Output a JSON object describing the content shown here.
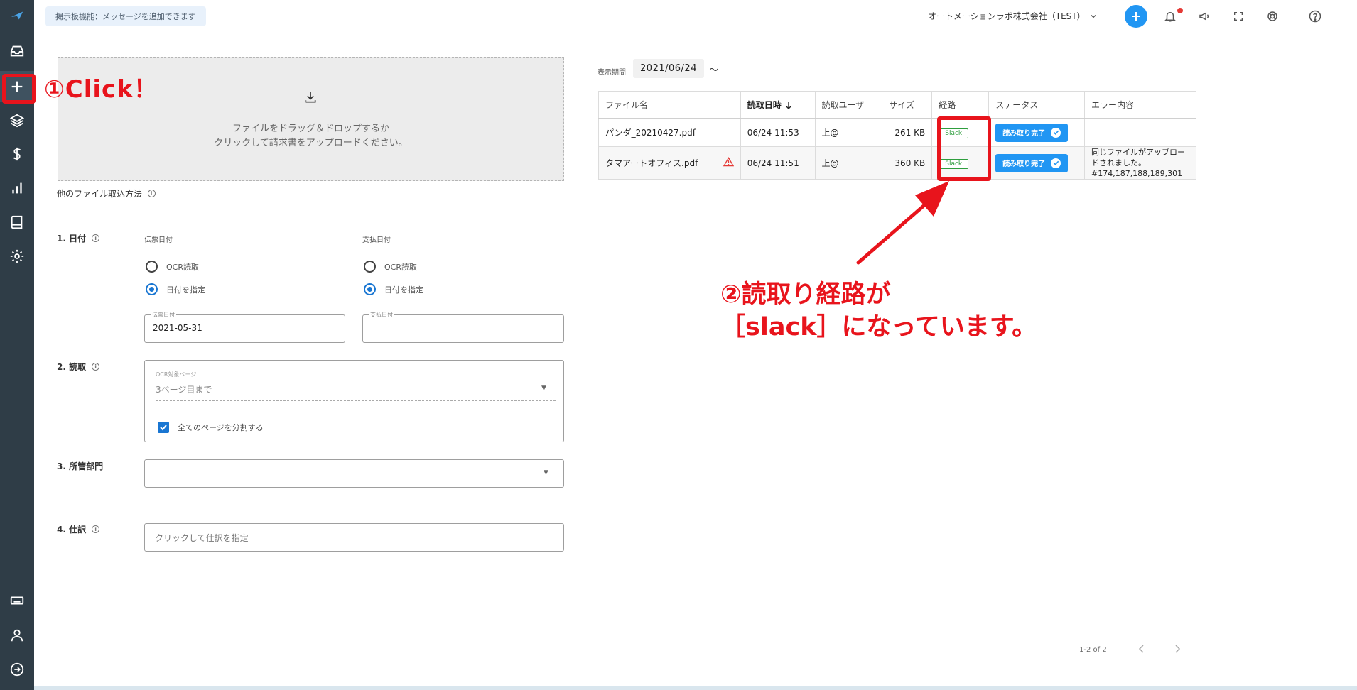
{
  "topbar": {
    "notice": "掲示板機能：メッセージを追加できます",
    "company": "オートメーションラボ株式会社（TEST）"
  },
  "upload": {
    "line1": "ファイルをドラッグ＆ドロップするか",
    "line2": "クリックして請求書をアップロードください。"
  },
  "other_import": "他のファイル取込方法",
  "form": {
    "date_section": "1. 日付",
    "slip_date_label": "伝票日付",
    "pay_date_label": "支払日付",
    "ocr_option": "OCR読取",
    "specify_option": "日付を指定",
    "slip_field_label": "伝票日付",
    "slip_field_value": "2021-05-31",
    "pay_field_label": "支払日付",
    "read_section": "2. 読取",
    "ocr_pages_label": "OCR対象ページ",
    "ocr_pages_value": "3ページ目まで",
    "split_pages": "全てのページを分割する",
    "dept_section": "3. 所管部門",
    "journal_section": "4. 仕訳",
    "journal_placeholder": "クリックして仕訳を指定"
  },
  "period": {
    "label": "表示期間",
    "value": "2021/06/24",
    "tilde": "〜"
  },
  "table": {
    "headers": [
      "ファイル名",
      "読取日時",
      "読取ユーザ",
      "サイズ",
      "経路",
      "ステータス",
      "エラー内容"
    ],
    "rows": [
      {
        "file": "パンダ_20210427.pdf",
        "datetime": "06/24  11:53",
        "user": "上@",
        "size": "261 KB",
        "route": "Slack",
        "status": "読み取り完了",
        "error": ""
      },
      {
        "file": "タマアートオフィス.pdf",
        "datetime": "06/24  11:51",
        "user": "上@",
        "size": "360 KB",
        "route": "Slack",
        "status": "読み取り完了",
        "error_line1": "同じファイルがアップロー",
        "error_line2": "ドされました。",
        "error_line3": "#174,187,188,189,301"
      }
    ]
  },
  "pager": {
    "text": "1-2 of 2"
  },
  "annotations": {
    "step1": "①Click！",
    "step2_line1": "②読取り経路が",
    "step2_line2": "［slack］になっています。"
  },
  "colors": {
    "accent": "#2196f3",
    "annotation_red": "#e8141c",
    "sidebar": "#2f3d47",
    "slack_green": "#2e9e3e"
  }
}
